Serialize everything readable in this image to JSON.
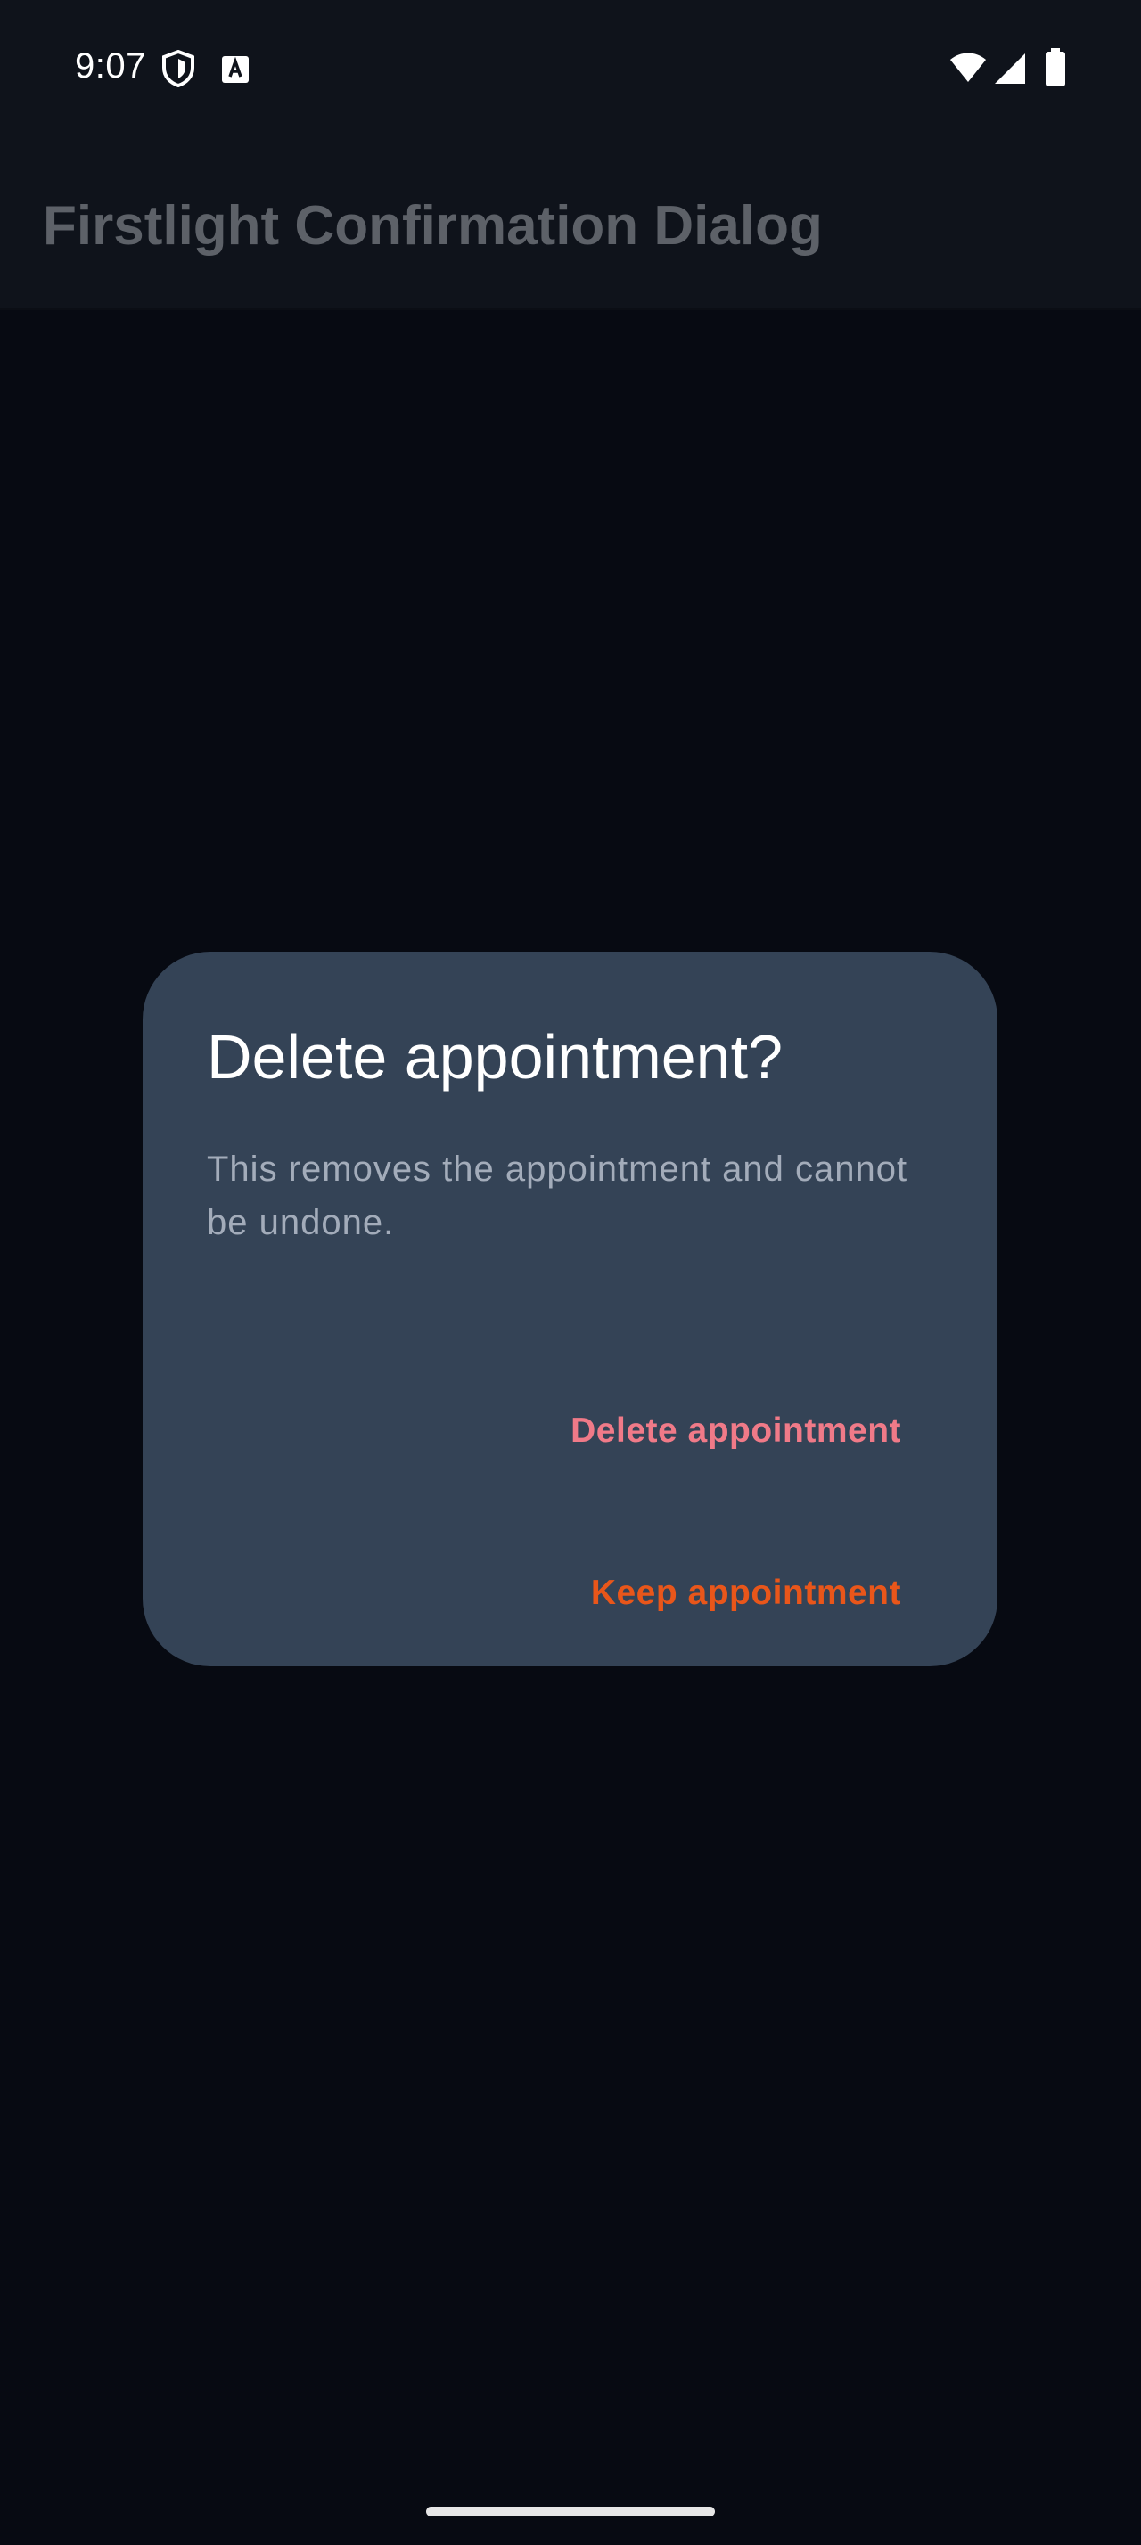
{
  "status_bar": {
    "time": "9:07",
    "icons_left": [
      "shield-icon",
      "keyboard-a-icon"
    ],
    "icons_right": [
      "wifi-icon",
      "cellular-signal-icon",
      "battery-icon"
    ]
  },
  "app_bar": {
    "title": "Firstlight Confirmation Dialog"
  },
  "dialog": {
    "title": "Delete appointment?",
    "body": "This removes the appointment and cannot be undone.",
    "delete_label": "Delete appointment",
    "keep_label": "Keep appointment"
  },
  "colors": {
    "background": "#070a12",
    "app_bar": "#0f131b",
    "dialog_surface": "#344356",
    "destructive_action": "#f07a88",
    "accent_action": "#e9561a",
    "body_text": "#a3acba"
  }
}
